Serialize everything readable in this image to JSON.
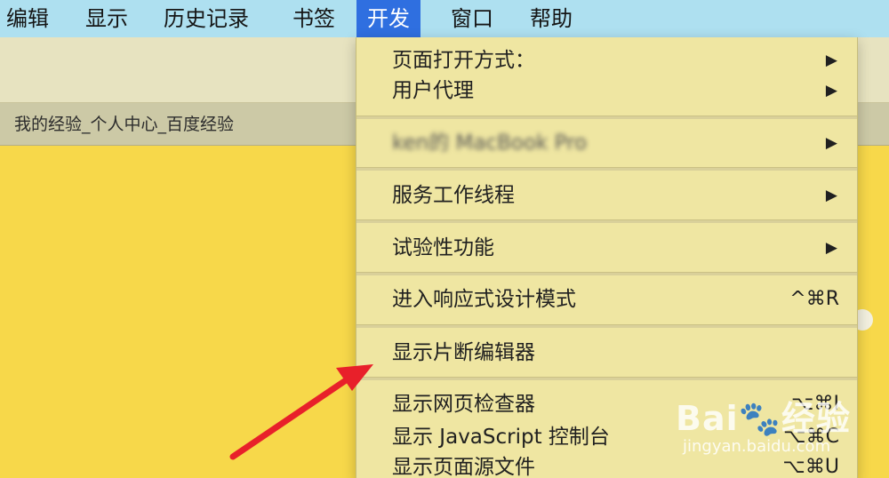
{
  "menubar": {
    "items": [
      {
        "label": "编辑"
      },
      {
        "label": "显示"
      },
      {
        "label": "历史记录"
      },
      {
        "label": "书签"
      },
      {
        "label": "开发"
      },
      {
        "label": "窗口"
      },
      {
        "label": "帮助"
      }
    ],
    "active": "开发"
  },
  "tab": {
    "title": "我的经验_个人中心_百度经验"
  },
  "dropdown": {
    "items": [
      {
        "label": "页面打开方式：",
        "submenu": "▶"
      },
      {
        "label": "用户代理",
        "submenu": "▶"
      },
      {
        "label": "ken的 MacBook Pro",
        "submenu": "▶"
      },
      {
        "label": "服务工作线程",
        "submenu": "▶"
      },
      {
        "label": "试验性功能",
        "submenu": "▶"
      },
      {
        "label": "进入响应式设计模式",
        "shortcut": "^⌘R"
      },
      {
        "label": "显示片断编辑器"
      },
      {
        "label": "显示网页检查器",
        "shortcut": "⌥⌘I"
      },
      {
        "label": "显示 JavaScript 控制台",
        "shortcut": "⌥⌘C"
      },
      {
        "label": "显示页面源文件",
        "shortcut": "⌥⌘U"
      }
    ]
  },
  "watermark": {
    "main": "Bai🐾经验",
    "sub": "jingyan.baidu.com"
  },
  "colors": {
    "menubar_bg": "#aee0f0",
    "active_menu": "#2f6fe0",
    "dropdown_bg": "#efe6a2",
    "page_bg": "#f7d84a",
    "arrow": "#e8202a"
  }
}
